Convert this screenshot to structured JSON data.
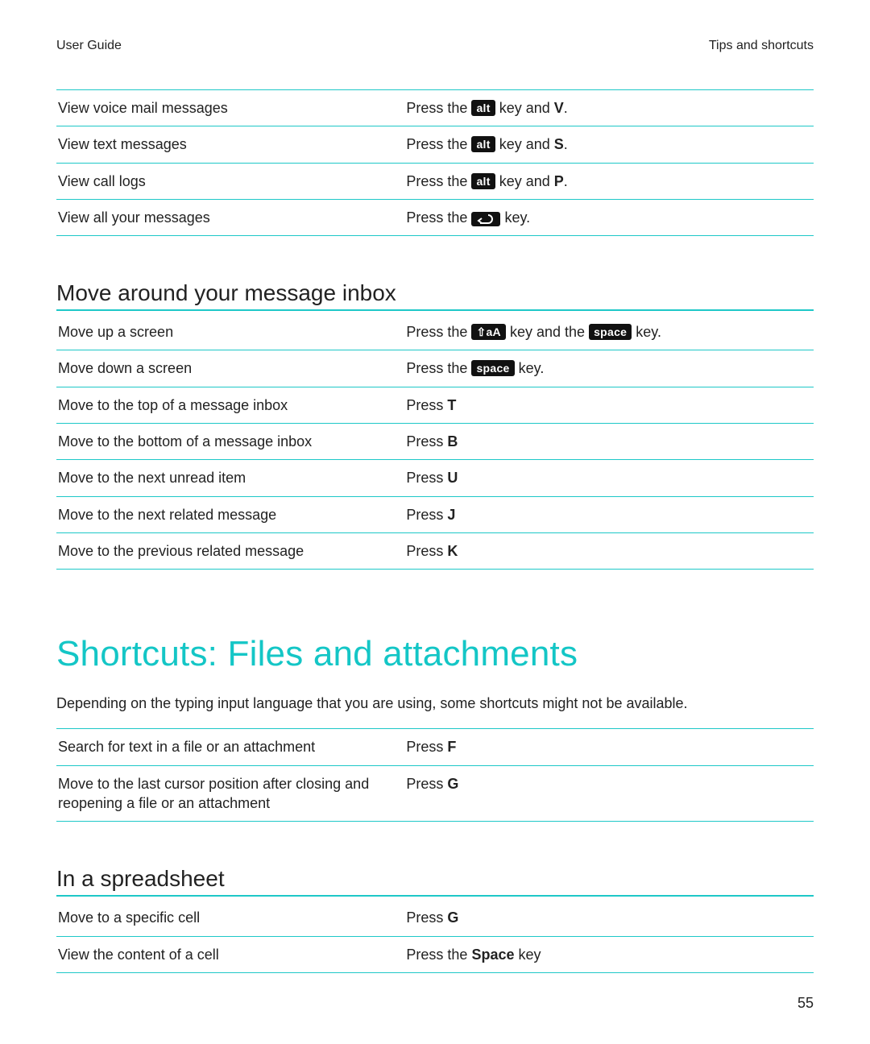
{
  "header": {
    "left": "User Guide",
    "right": "Tips and shortcuts"
  },
  "text": {
    "press_the": "Press the ",
    "key_and": " key and ",
    "key_and_the": " key and the ",
    "key_period": " key.",
    "press": "Press ",
    "space_key_word": " key"
  },
  "keys": {
    "alt": "alt",
    "space": "space",
    "shift_aA": "⇧aA"
  },
  "letters": {
    "V": "V",
    "S": "S",
    "P": "P",
    "T": "T",
    "B": "B",
    "U": "U",
    "J": "J",
    "K": "K",
    "F": "F",
    "G": "G",
    "Space": "Space"
  },
  "table1_rows": [
    {
      "action": "View voice mail messages"
    },
    {
      "action": "View text messages"
    },
    {
      "action": "View call logs"
    },
    {
      "action": "View all your messages"
    }
  ],
  "section_move": {
    "heading": "Move around your message inbox"
  },
  "table2_rows": [
    {
      "action": "Move up a screen"
    },
    {
      "action": "Move down a screen"
    },
    {
      "action": "Move to the top of a message inbox"
    },
    {
      "action": "Move to the bottom of a message inbox"
    },
    {
      "action": "Move to the next unread item"
    },
    {
      "action": "Move to the next related message"
    },
    {
      "action": "Move to the previous related message"
    }
  ],
  "section_files": {
    "heading": "Shortcuts: Files and attachments",
    "intro": "Depending on the typing input language that you are using, some shortcuts might not be available."
  },
  "table3_rows": [
    {
      "action": "Search for text in a file or an attachment"
    },
    {
      "action": "Move to the last cursor position after closing and reopening a file or an attachment"
    }
  ],
  "section_spreadsheet": {
    "heading": "In a spreadsheet"
  },
  "table4_rows": [
    {
      "action": "Move to a specific cell"
    },
    {
      "action": "View the content of a cell"
    }
  ],
  "page_number": "55"
}
